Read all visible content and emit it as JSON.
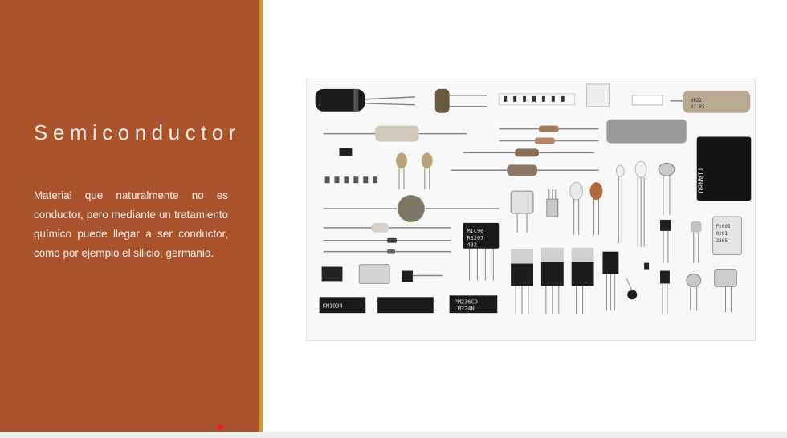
{
  "slide": {
    "title": "Semiconductor",
    "body": "Material que naturalmente no es conductor, pero mediante un tratamiento químico puede llegar a ser conductor, como por ejemplo el silicio, germanio."
  },
  "photo": {
    "subject": "electronic components",
    "markings": {
      "bridge": [
        "MIC96",
        "RS207",
        "432"
      ],
      "ic1": "KM1034",
      "ic2": "PM236CD",
      "ic3": "LM324N",
      "relay": "TIANBO",
      "sensor": [
        "P2005",
        "0201",
        "2205"
      ]
    }
  },
  "colors": {
    "panel": "#a8532c",
    "stripe": "#d49a28",
    "accent_dot": "#e02a1e",
    "text": "#f8efe8"
  }
}
